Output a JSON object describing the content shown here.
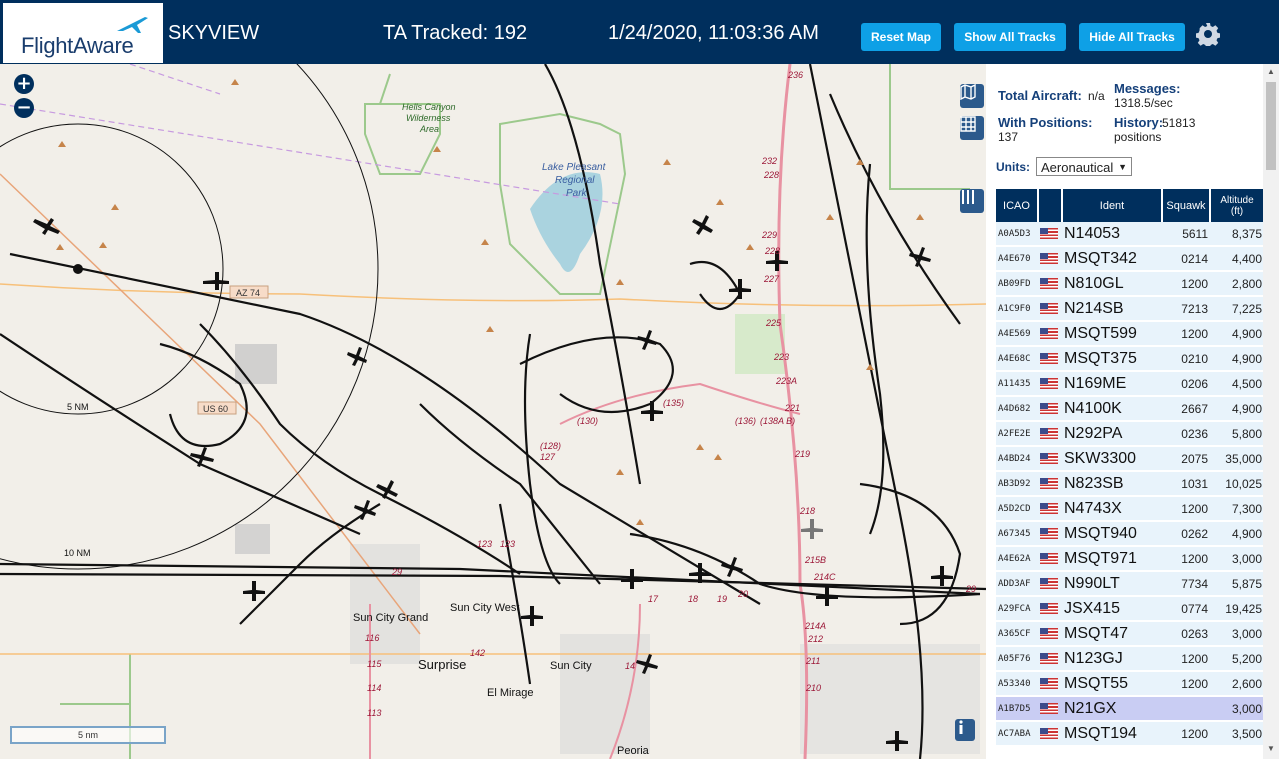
{
  "header": {
    "logo_text": "FlightAware",
    "app_name": "SKYVIEW",
    "tracked_label": "TA Tracked: 192",
    "datetime": "1/24/2020, 11:03:36 AM",
    "reset_map": "Reset Map",
    "show_all_tracks": "Show All Tracks",
    "hide_all_tracks": "Hide All Tracks",
    "settings_icon": "gear-icon"
  },
  "map": {
    "zoom_in": "+",
    "zoom_out": "−",
    "scale_label": "5 nm",
    "range_ring_labels": [
      "5 NM",
      "10 NM"
    ],
    "place_labels": [
      "Hells Canyon Wilderness Area",
      "Lake Pleasant Regional Park",
      "Sun City West",
      "Sun City Grand",
      "Surprise",
      "Sun City",
      "El Mirage",
      "Peoria"
    ],
    "highway_labels": [
      "AZ 74",
      "US 60"
    ],
    "road_labels": [
      "236",
      "232",
      "229",
      "228",
      "227",
      "225",
      "223",
      "223A",
      "221",
      "218",
      "219",
      "215B",
      "214C",
      "214A",
      "212",
      "211",
      "210",
      "123",
      "127",
      "(128)",
      "(130)",
      "(135)",
      "(136)",
      "(138A B)",
      "29",
      "142",
      "17",
      "18",
      "19",
      "20",
      "116",
      "115",
      "114",
      "113",
      "14"
    ],
    "tools": [
      "map-icon",
      "grid-icon",
      "columns-icon",
      "info-icon"
    ]
  },
  "panel": {
    "total_aircraft_label": "Total Aircraft:",
    "total_aircraft_value": "n/a",
    "messages_label": "Messages:",
    "messages_value": "1318.5/sec",
    "with_positions_label": "With Positions:",
    "with_positions_value": "137",
    "history_label": "History:",
    "history_value": "51813",
    "history_unit": "positions",
    "units_label": "Units:",
    "units_value": "Aeronautical"
  },
  "table": {
    "columns": [
      "ICAO",
      "",
      "Ident",
      "Squawk",
      "Altitude (ft)"
    ],
    "rows": [
      {
        "icao": "A0A5D3",
        "ident": "N14053",
        "squawk": "5611",
        "altitude": "8,375"
      },
      {
        "icao": "A4E670",
        "ident": "MSQT342",
        "squawk": "0214",
        "altitude": "4,400"
      },
      {
        "icao": "AB09FD",
        "ident": "N810GL",
        "squawk": "1200",
        "altitude": "2,800"
      },
      {
        "icao": "A1C9F0",
        "ident": "N214SB",
        "squawk": "7213",
        "altitude": "7,225"
      },
      {
        "icao": "A4E569",
        "ident": "MSQT599",
        "squawk": "1200",
        "altitude": "4,900"
      },
      {
        "icao": "A4E68C",
        "ident": "MSQT375",
        "squawk": "0210",
        "altitude": "4,900"
      },
      {
        "icao": "A11435",
        "ident": "N169ME",
        "squawk": "0206",
        "altitude": "4,500"
      },
      {
        "icao": "A4D682",
        "ident": "N4100K",
        "squawk": "2667",
        "altitude": "4,900"
      },
      {
        "icao": "A2FE2E",
        "ident": "N292PA",
        "squawk": "0236",
        "altitude": "5,800"
      },
      {
        "icao": "A4BD24",
        "ident": "SKW3300",
        "squawk": "2075",
        "altitude": "35,000"
      },
      {
        "icao": "AB3D92",
        "ident": "N823SB",
        "squawk": "1031",
        "altitude": "10,025"
      },
      {
        "icao": "A5D2CD",
        "ident": "N4743X",
        "squawk": "1200",
        "altitude": "7,300"
      },
      {
        "icao": "A67345",
        "ident": "MSQT940",
        "squawk": "0262",
        "altitude": "4,900"
      },
      {
        "icao": "A4E62A",
        "ident": "MSQT971",
        "squawk": "1200",
        "altitude": "3,000"
      },
      {
        "icao": "ADD3AF",
        "ident": "N990LT",
        "squawk": "7734",
        "altitude": "5,875"
      },
      {
        "icao": "A29FCA",
        "ident": "JSX415",
        "squawk": "0774",
        "altitude": "19,425"
      },
      {
        "icao": "A365CF",
        "ident": "MSQT47",
        "squawk": "0263",
        "altitude": "3,000"
      },
      {
        "icao": "A05F76",
        "ident": "N123GJ",
        "squawk": "1200",
        "altitude": "5,200"
      },
      {
        "icao": "A53340",
        "ident": "MSQT55",
        "squawk": "1200",
        "altitude": "2,600"
      },
      {
        "icao": "A1B7D5",
        "ident": "N21GX",
        "squawk": "",
        "altitude": "3,000",
        "selected": true
      },
      {
        "icao": "AC7ABA",
        "ident": "MSQT194",
        "squawk": "1200",
        "altitude": "3,500"
      }
    ]
  },
  "colors": {
    "header_bg": "#002f5d",
    "button_bg": "#0ea0e6",
    "selected_row": "#c9cdf3",
    "row_bg": "#e8f3fb"
  }
}
